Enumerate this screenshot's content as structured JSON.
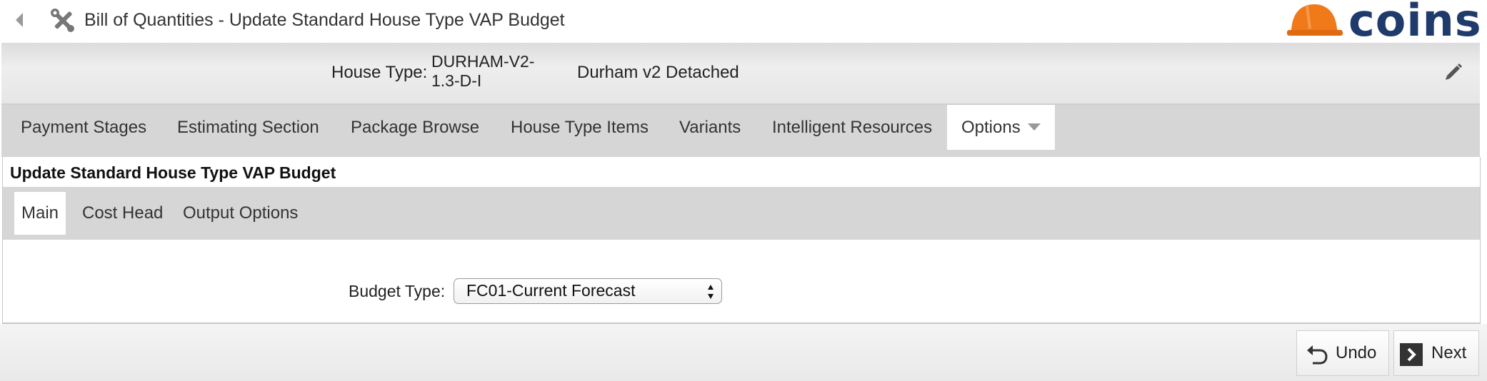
{
  "window": {
    "title": "Bill of Quantities - Update Standard House Type VAP Budget",
    "back_icon": "back-arrow-icon",
    "app_icon": "tools-icon",
    "brand": "coins"
  },
  "header": {
    "house_type_label": "House Type:",
    "house_type_code": "DURHAM-V2-1.3-D-I",
    "house_type_name": "Durham v2 Detached",
    "edit_icon": "pencil-icon"
  },
  "tabs": [
    {
      "label": "Payment Stages"
    },
    {
      "label": "Estimating Section"
    },
    {
      "label": "Package Browse"
    },
    {
      "label": "House Type Items"
    },
    {
      "label": "Variants"
    },
    {
      "label": "Intelligent Resources"
    },
    {
      "label": "Options",
      "active": true
    }
  ],
  "section": {
    "title": "Update Standard House Type VAP Budget",
    "subtabs": [
      {
        "label": "Main",
        "active": true
      },
      {
        "label": "Cost Head"
      },
      {
        "label": "Output Options"
      }
    ],
    "budget_type_label": "Budget Type:",
    "budget_type_value": "FC01-Current Forecast"
  },
  "footer": {
    "undo_label": "Undo",
    "next_label": "Next"
  },
  "colors": {
    "brand_navy": "#1f3b6b",
    "brand_orange": "#f07a1a",
    "tab_bar": "#d6d6d6"
  }
}
